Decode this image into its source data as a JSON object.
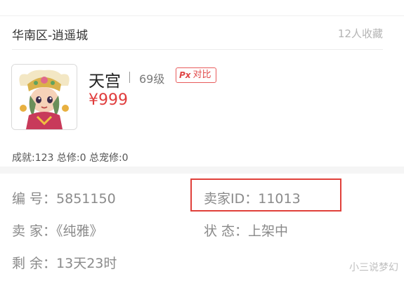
{
  "header": {
    "server": "华南区-逍遥城",
    "favorites": "12人收藏"
  },
  "role": {
    "name": "天宫",
    "level": "69级",
    "compare_badge": "Px",
    "compare_label": "对比",
    "price": "¥999",
    "achievements": "成就:123 总修:0 总宠修:0"
  },
  "info": {
    "id_label": "编 号：",
    "id_value": "5851150",
    "seller_id_label": "卖家ID：",
    "seller_id_value": "11013",
    "seller_label": "卖 家：",
    "seller_value": "《纯雅》",
    "status_label": "状 态：",
    "status_value": "上架中",
    "remain_label": "剩 余：",
    "remain_value": "13天23时"
  },
  "watermark": "小三说梦幻",
  "colors": {
    "price": "#e03c3c",
    "highlight_box": "#e0403a"
  }
}
